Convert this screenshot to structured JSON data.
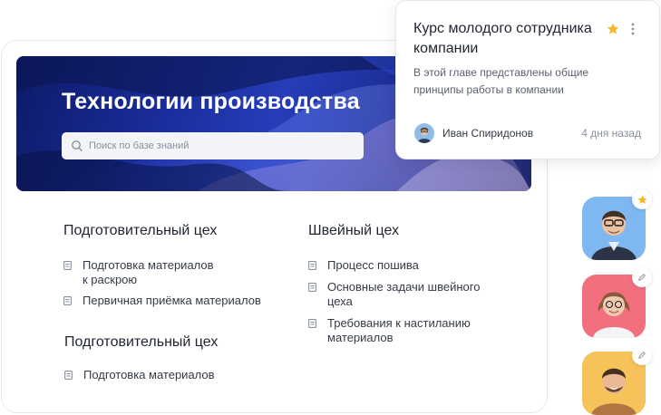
{
  "hero": {
    "title": "Технологии производства",
    "search_placeholder": "Поиск по базе знаний"
  },
  "sections": [
    {
      "title": "Подготовительный цех",
      "items": [
        "Подготовка материалов\nк раскрою",
        "Первичная приёмка материалов"
      ]
    },
    {
      "title": "Швейный цех",
      "items": [
        "Процесс пошива",
        "Основные задачи швейного\nцеха",
        "Требования к настиланию\nматериалов"
      ]
    },
    {
      "title": "Подготовительный цех",
      "items": [
        "Подготовка материалов"
      ]
    }
  ],
  "popup": {
    "title": "Курс молодого сотрудника компании",
    "description": "В этой главе представлены общие принципы работы в компании",
    "author": "Иван Спиридонов",
    "time": "4 дня назад"
  },
  "avatars": [
    {
      "bg": "#7fb7f0",
      "badge_icon": "star-icon"
    },
    {
      "bg": "#f2707e",
      "badge_icon": "pencil-icon"
    },
    {
      "bg": "#f6c25a",
      "badge_icon": "pencil-icon"
    }
  ],
  "colors": {
    "accent_star": "#f5b82e",
    "hero_dark": "#0d1a66"
  }
}
